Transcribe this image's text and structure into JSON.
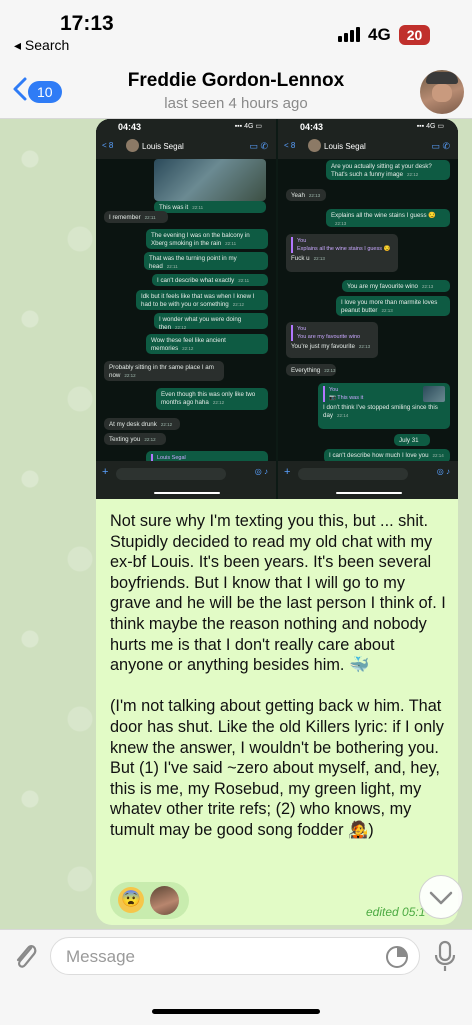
{
  "status_bar": {
    "time": "17:13",
    "back_app": "◂ Search",
    "network": "4G",
    "battery": "20"
  },
  "header": {
    "unread_count": "10",
    "title": "Freddie Gordon-Lennox",
    "subtitle": "last seen 4 hours ago"
  },
  "screenshot": {
    "left": {
      "time": "04:43",
      "status": "▪▪▪ 4G ▭",
      "nav": "< 8",
      "name": "Louis Segal",
      "messages": [
        {
          "text": "This was it",
          "time": "22:11"
        },
        {
          "text": "I remember",
          "time": "22:11"
        },
        {
          "text": "The evening I was on the balcony in Xberg smoking in the rain",
          "time": "22:11"
        },
        {
          "text": "That was the turning point in my head",
          "time": "22:11"
        },
        {
          "text": "I can't describe what exactly",
          "time": "22:11"
        },
        {
          "text": "Idk but it feels like that was when I knew I had to be with you or something",
          "time": "22:12"
        },
        {
          "text": "I wonder what you were doing then",
          "time": "22:12"
        },
        {
          "text": "Wow these feel like ancient memories",
          "time": "22:12"
        },
        {
          "text": "Probably sitting in thr same place I am now",
          "time": "22:12"
        },
        {
          "text": "Even though this was only like two months ago haha",
          "time": "22:12"
        },
        {
          "text": "At my desk drunk",
          "time": "22:12"
        },
        {
          "text": "Texting you",
          "time": "22:12"
        }
      ],
      "reply_preview": "Louis Segal"
    },
    "right": {
      "time": "04:43",
      "status": "▪▪▪ 4G ▭",
      "nav": "< 8",
      "name": "Louis Segal",
      "messages": [
        {
          "text": "Are you actually sitting at your desk? That's such a funny image",
          "time": "22:12"
        },
        {
          "text": "Yeah",
          "time": "22:13"
        },
        {
          "text": "Explains all the wine stains I guess 😏",
          "time": "22:13"
        },
        {
          "quote_author": "You",
          "quote": "Explains all the wine stains I guess 😏",
          "text": "Fuck u",
          "time": "22:13"
        },
        {
          "text": "You are my favourite wino",
          "time": "22:13"
        },
        {
          "text": "I love you more than marmite loves peanut butter",
          "time": "22:13"
        },
        {
          "quote_author": "You",
          "quote": "You are my favourite wino",
          "text": "You're just my favourite",
          "time": "22:13"
        },
        {
          "text": "Everything",
          "time": "22:13"
        },
        {
          "quote_author": "You",
          "quote": "📷 This was it",
          "text": "I don't think I've stopped smiling since this day",
          "time": "22:14"
        },
        {
          "text": "July 31",
          "time": ""
        },
        {
          "text": "I can't describe how much I love you",
          "time": "22:14"
        }
      ]
    }
  },
  "message": {
    "text": "Not sure why I'm texting you this, but ... shit. Stupidly decided to read my old chat with my ex-bf Louis. It's been years. It's been several boyfriends. But I know that I will go to my grave and he will be the last person I think of. I think maybe the reason nothing and nobody hurts me is that I don't really care about anyone or anything besides him. 🐳\n\n(I'm not talking about getting back w him. That door has shut. Like the old Killers lyric: if I only knew the answer, I wouldn't be bothering you. But (1) I've said ~zero about myself, and, hey, this is me, my Rosebud, my green light, my whatev other trite refs; (2) who knows, my tumult may be good song fodder 🧑‍🎤)",
    "reaction_emoji": "😨",
    "edited": "edited 05:1"
  },
  "composer": {
    "placeholder": "Message"
  },
  "colors": {
    "accent": "#2f7cf6",
    "bubble": "#e2fbc6",
    "edited": "#4caa42",
    "battery": "#c0302c"
  },
  "icons": [
    "back-chevron-icon",
    "paperclip-icon",
    "sticker-icon",
    "microphone-icon",
    "chevron-down-icon"
  ]
}
